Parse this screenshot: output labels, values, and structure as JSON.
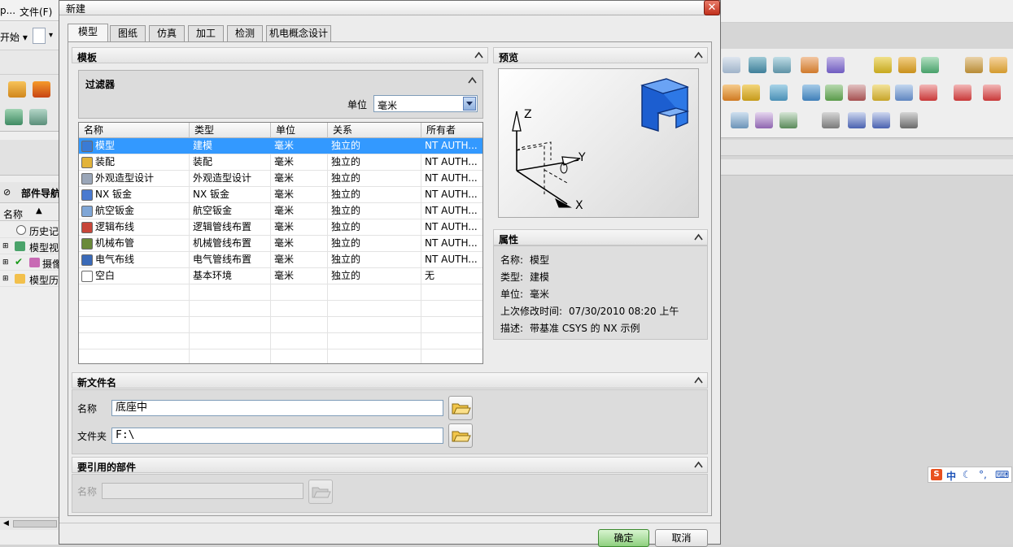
{
  "background_app": {
    "menu": [
      "p...",
      "文件(F)"
    ],
    "start_label": "开始",
    "nav_title": "部件导航",
    "nav_column": "名称",
    "tree": [
      "历史记",
      "模型视",
      "摄像",
      "模型历"
    ]
  },
  "dialog": {
    "title": "新建",
    "tabs": [
      "模型",
      "图纸",
      "仿真",
      "加工",
      "检测",
      "机电概念设计"
    ],
    "templates": {
      "section_title": "模板",
      "filter_title": "过滤器",
      "unit_label": "单位",
      "unit_value": "毫米",
      "columns": [
        "名称",
        "类型",
        "单位",
        "关系",
        "所有者"
      ],
      "rows": [
        {
          "name": "模型",
          "type": "建模",
          "unit": "毫米",
          "rel": "独立的",
          "owner": "NT AUTH...",
          "icon": "model-icon"
        },
        {
          "name": "装配",
          "type": "装配",
          "unit": "毫米",
          "rel": "独立的",
          "owner": "NT AUTH...",
          "icon": "assembly-icon"
        },
        {
          "name": "外观造型设计",
          "type": "外观造型设计",
          "unit": "毫米",
          "rel": "独立的",
          "owner": "NT AUTH...",
          "icon": "shape-design-icon"
        },
        {
          "name": "NX 钣金",
          "type": "NX 钣金",
          "unit": "毫米",
          "rel": "独立的",
          "owner": "NT AUTH...",
          "icon": "sheet-metal-icon"
        },
        {
          "name": "航空钣金",
          "type": "航空钣金",
          "unit": "毫米",
          "rel": "独立的",
          "owner": "NT AUTH...",
          "icon": "aero-sheet-metal-icon"
        },
        {
          "name": "逻辑布线",
          "type": "逻辑管线布置",
          "unit": "毫米",
          "rel": "独立的",
          "owner": "NT AUTH...",
          "icon": "logical-routing-icon"
        },
        {
          "name": "机械布管",
          "type": "机械管线布置",
          "unit": "毫米",
          "rel": "独立的",
          "owner": "NT AUTH...",
          "icon": "mechanical-routing-icon"
        },
        {
          "name": "电气布线",
          "type": "电气管线布置",
          "unit": "毫米",
          "rel": "独立的",
          "owner": "NT AUTH...",
          "icon": "electrical-routing-icon"
        },
        {
          "name": "空白",
          "type": "基本环境",
          "unit": "毫米",
          "rel": "独立的",
          "owner": "无",
          "icon": "blank-icon"
        }
      ]
    },
    "preview": {
      "section_title": "预览",
      "axis_labels": [
        "Z",
        "Y",
        "X"
      ]
    },
    "properties": {
      "section_title": "属性",
      "rows": [
        {
          "label": "名称:",
          "value": "模型"
        },
        {
          "label": "类型:",
          "value": "建模"
        },
        {
          "label": "单位:",
          "value": "毫米"
        },
        {
          "label": "上次修改时间:",
          "value": "07/30/2010 08:20 上午"
        },
        {
          "label": "描述:",
          "value": "带基准 CSYS 的 NX 示例"
        }
      ]
    },
    "new_file": {
      "section_title": "新文件名",
      "name_label": "名称",
      "name_value": "底座中",
      "folder_label": "文件夹",
      "folder_value": "F:\\"
    },
    "referenced_part": {
      "section_title": "要引用的部件",
      "name_label": "名称",
      "name_value": ""
    },
    "ok_label": "确定",
    "cancel_label": "取消"
  },
  "ime": {
    "label": "中"
  },
  "colors": {
    "selection": "#3399ff",
    "ok_button": "#8fd07f",
    "close_button": "#c1301c"
  }
}
